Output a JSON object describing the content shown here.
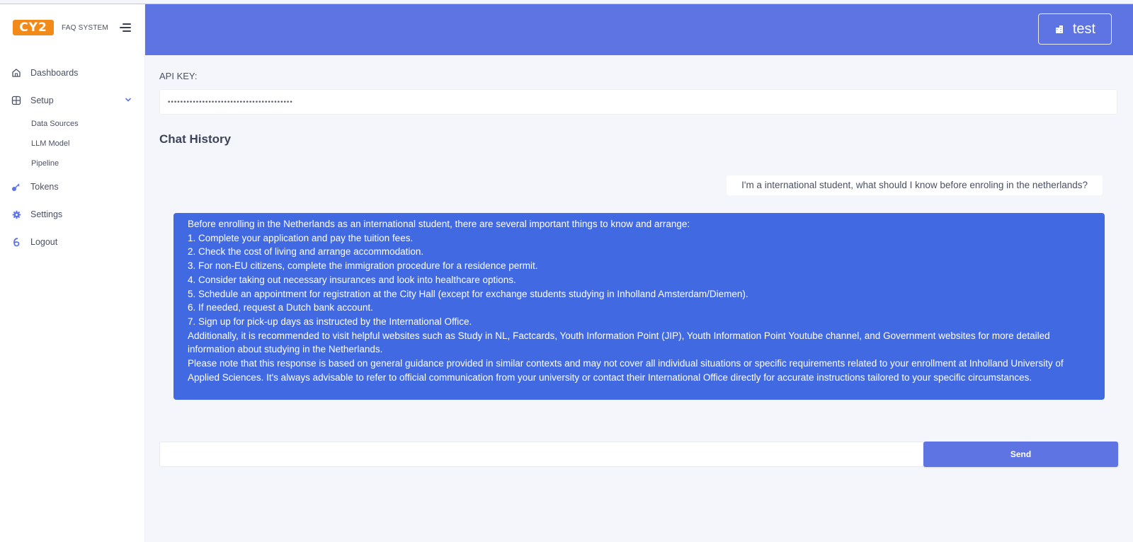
{
  "brand": {
    "logo_text": "CY2",
    "app_name": "FAQ SYSTEM",
    "logo_color": "#f28a1a"
  },
  "sidebar": {
    "items": [
      {
        "label": "Dashboards",
        "icon": "home-icon"
      },
      {
        "label": "Setup",
        "icon": "grid-icon",
        "expanded": true,
        "children": [
          "Data Sources",
          "LLM Model",
          "Pipeline"
        ]
      },
      {
        "label": "Tokens",
        "icon": "key-icon"
      },
      {
        "label": "Settings",
        "icon": "gear-icon"
      },
      {
        "label": "Logout",
        "icon": "logout-icon"
      }
    ]
  },
  "header": {
    "user_label": "test",
    "color": "#5f74e3"
  },
  "api": {
    "label": "API KEY:",
    "value": "••••••••••••••••••••••••••••••••••••••••"
  },
  "chat": {
    "title": "Chat History",
    "user_message": "I'm a international student, what should I know before enroling in the netherlands?",
    "bot_lines": [
      "Before enrolling in the Netherlands as an international student, there are several important things to know and arrange:",
      "1. Complete your application and pay the tuition fees.",
      "2. Check the cost of living and arrange accommodation.",
      "3. For non-EU citizens, complete the immigration procedure for a residence permit.",
      "4. Consider taking out necessary insurances and look into healthcare options.",
      "5. Schedule an appointment for registration at the City Hall (except for exchange students studying in Inholland Amsterdam/Diemen).",
      "6. If needed, request a Dutch bank account.",
      "7. Sign up for pick-up days as instructed by the International Office.",
      "Additionally, it is recommended to visit helpful websites such as Study in NL, Factcards, Youth Information Point (JIP), Youth Information Point Youtube channel, and Government websites for more detailed information about studying in the Netherlands.",
      "Please note that this response is based on general guidance provided in similar contexts and may not cover all individual situations or specific requirements related to your enrollment at Inholland University of Applied Sciences. It's always advisable to refer to official communication from your university or contact their International Office directly for accurate instructions tailored to your specific circumstances."
    ],
    "bot_color": "#4169e1"
  },
  "composer": {
    "input_value": "",
    "send_label": "Send"
  }
}
